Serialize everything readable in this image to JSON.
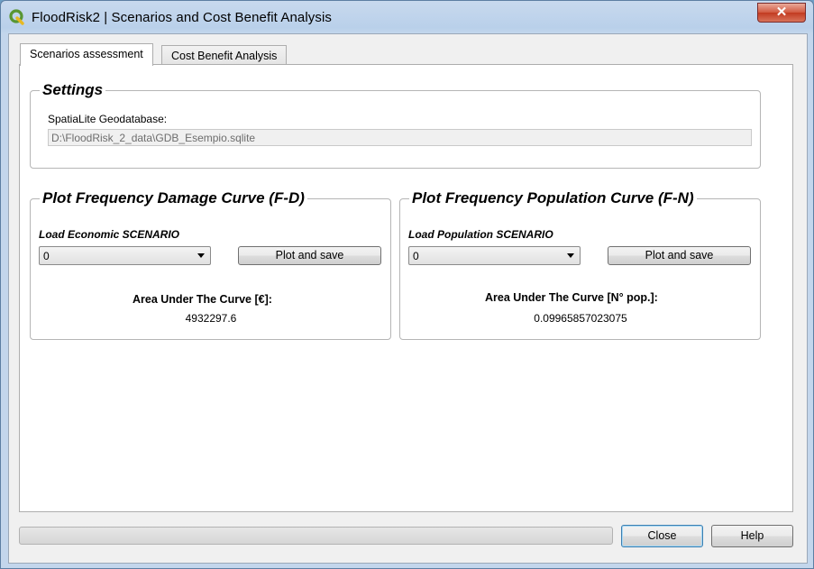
{
  "window": {
    "title": "FloodRisk2 | Scenarios and Cost Benefit Analysis",
    "close_glyph": "✕"
  },
  "tabs": [
    {
      "label": "Scenarios assessment",
      "active": true
    },
    {
      "label": "Cost Benefit Analysis",
      "active": false
    }
  ],
  "settings": {
    "title": "Settings",
    "geodb_label": "SpatiaLite Geodatabase:",
    "geodb_value": "D:\\FloodRisk_2_data\\GDB_Esempio.sqlite"
  },
  "fd_group": {
    "title": "Plot Frequency Damage Curve (F-D)",
    "load_label": "Load Economic SCENARIO",
    "combo_value": "0",
    "plot_button": "Plot and save",
    "area_label": "Area Under The Curve [€]:",
    "area_value": "4932297.6"
  },
  "fn_group": {
    "title": "Plot Frequency Population Curve (F-N)",
    "load_label": "Load Population SCENARIO",
    "combo_value": "0",
    "plot_button": "Plot and save",
    "area_label": "Area Under The Curve [N° pop.]:",
    "area_value": "0.09965857023075"
  },
  "footer": {
    "progress_percent": 0,
    "close_button": "Close",
    "help_button": "Help"
  },
  "colors": {
    "qgis_green": "#589632",
    "close_red": "#c7452a"
  }
}
